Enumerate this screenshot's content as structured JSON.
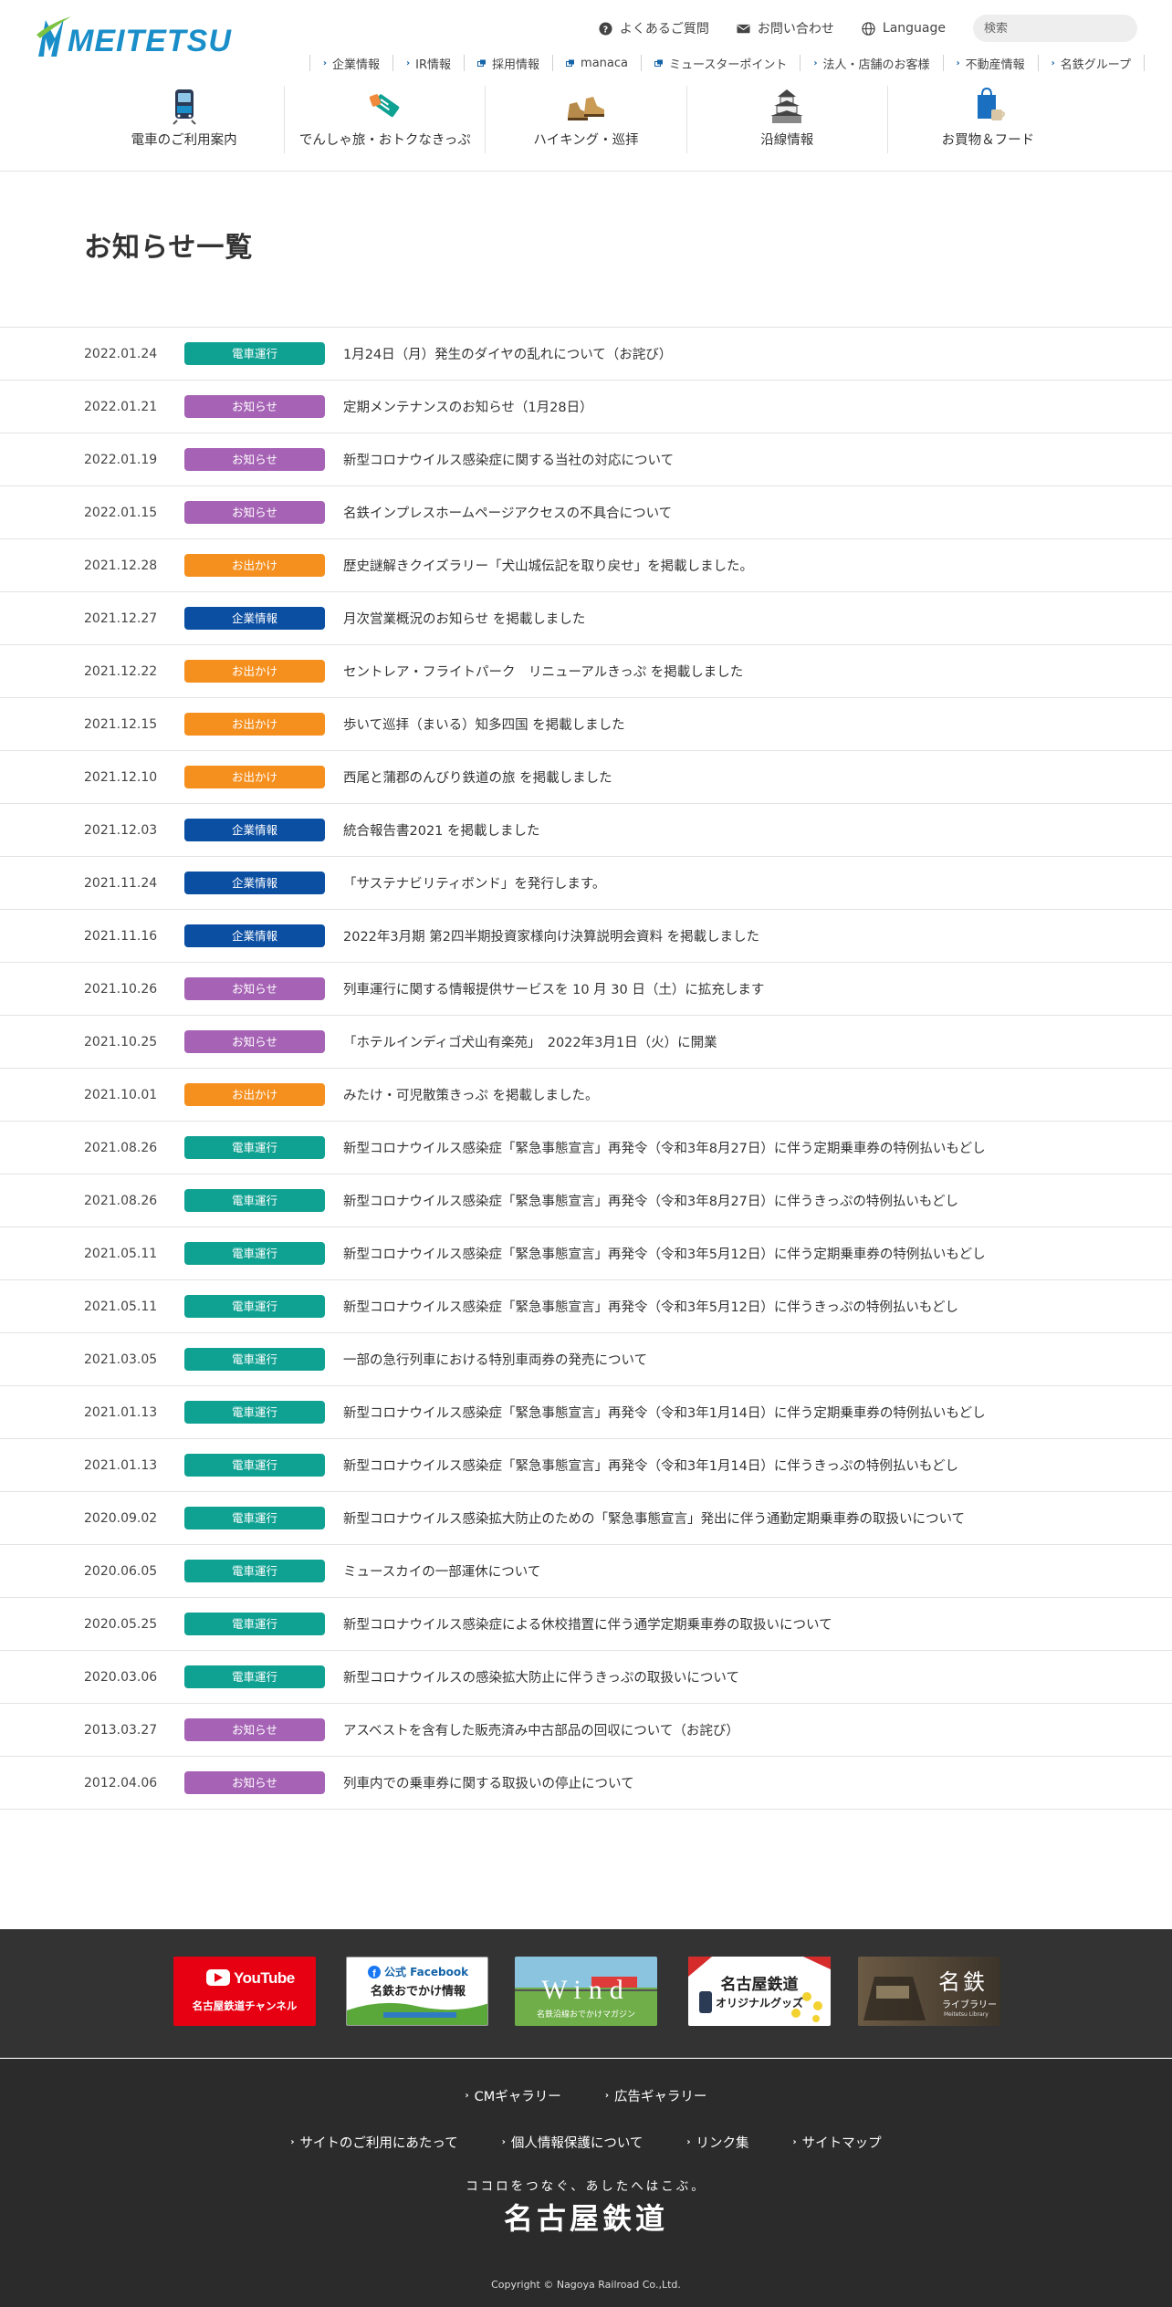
{
  "header": {
    "logo_text": "MEITETSU",
    "util": {
      "faq": "よくあるご質問",
      "contact": "お問い合わせ",
      "language": "Language",
      "search_placeholder": "検索"
    },
    "subnav": [
      "企業情報",
      "IR情報",
      "採用情報",
      "manaca",
      "ミュースターポイント",
      "法人・店舗のお客様",
      "不動産情報",
      "名鉄グループ"
    ],
    "mainnav": [
      {
        "label": "電車のご利用案内",
        "icon": "train-icon"
      },
      {
        "label": "でんしゃ旅・おトクなきっぷ",
        "icon": "ticket-icon"
      },
      {
        "label": "ハイキング・巡拝",
        "icon": "hiking-boots-icon"
      },
      {
        "label": "沿線情報",
        "icon": "castle-icon"
      },
      {
        "label": "お買物＆フード",
        "icon": "shopping-bag-icon"
      }
    ]
  },
  "page_title": "お知らせ一覧",
  "categories": {
    "train": {
      "label": "電車運行",
      "color": "#0fa192"
    },
    "notice": {
      "label": "お知らせ",
      "color": "#a663b5"
    },
    "outing": {
      "label": "お出かけ",
      "color": "#f5901f"
    },
    "corporate": {
      "label": "企業情報",
      "color": "#0b4fa3"
    }
  },
  "news": [
    {
      "date": "2022.01.24",
      "cat": "train",
      "label": "電車運行",
      "title": "1月24日（月）発生のダイヤの乱れについて（お詫び）"
    },
    {
      "date": "2022.01.21",
      "cat": "notice",
      "label": "お知らせ",
      "title": "定期メンテナンスのお知らせ（1月28日）"
    },
    {
      "date": "2022.01.19",
      "cat": "notice",
      "label": "お知らせ",
      "title": "新型コロナウイルス感染症に関する当社の対応について"
    },
    {
      "date": "2022.01.15",
      "cat": "notice",
      "label": "お知らせ",
      "title": "名鉄インプレスホームページアクセスの不具合について"
    },
    {
      "date": "2021.12.28",
      "cat": "outing",
      "label": "お出かけ",
      "title": "歴史謎解きクイズラリー「犬山城伝記を取り戻せ」を掲載しました。"
    },
    {
      "date": "2021.12.27",
      "cat": "corporate",
      "label": "企業情報",
      "title": "月次営業概況のお知らせ を掲載しました"
    },
    {
      "date": "2021.12.22",
      "cat": "outing",
      "label": "お出かけ",
      "title": "セントレア・フライトパーク　リニューアルきっぷ を掲載しました"
    },
    {
      "date": "2021.12.15",
      "cat": "outing",
      "label": "お出かけ",
      "title": "歩いて巡拝（まいる）知多四国 を掲載しました"
    },
    {
      "date": "2021.12.10",
      "cat": "outing",
      "label": "お出かけ",
      "title": "西尾と蒲郡のんびり鉄道の旅 を掲載しました"
    },
    {
      "date": "2021.12.03",
      "cat": "corporate",
      "label": "企業情報",
      "title": "統合報告書2021 を掲載しました"
    },
    {
      "date": "2021.11.24",
      "cat": "corporate",
      "label": "企業情報",
      "title": "「サステナビリティボンド」を発行します。"
    },
    {
      "date": "2021.11.16",
      "cat": "corporate",
      "label": "企業情報",
      "title": "2022年3月期 第2四半期投資家様向け決算説明会資料 を掲載しました"
    },
    {
      "date": "2021.10.26",
      "cat": "notice",
      "label": "お知らせ",
      "title": "列車運行に関する情報提供サービスを 10 月 30 日（土）に拡充します"
    },
    {
      "date": "2021.10.25",
      "cat": "notice",
      "label": "お知らせ",
      "title": "「ホテルインディゴ犬山有楽苑」　2022年3月1日（火）に開業"
    },
    {
      "date": "2021.10.01",
      "cat": "outing",
      "label": "お出かけ",
      "title": "みたけ・可児散策きっぷ を掲載しました。"
    },
    {
      "date": "2021.08.26",
      "cat": "train",
      "label": "電車運行",
      "title": "新型コロナウイルス感染症「緊急事態宣言」再発令（令和3年8月27日）に伴う定期乗車券の特例払いもどし"
    },
    {
      "date": "2021.08.26",
      "cat": "train",
      "label": "電車運行",
      "title": "新型コロナウイルス感染症「緊急事態宣言」再発令（令和3年8月27日）に伴うきっぷの特例払いもどし"
    },
    {
      "date": "2021.05.11",
      "cat": "train",
      "label": "電車運行",
      "title": "新型コロナウイルス感染症「緊急事態宣言」再発令（令和3年5月12日）に伴う定期乗車券の特例払いもどし"
    },
    {
      "date": "2021.05.11",
      "cat": "train",
      "label": "電車運行",
      "title": "新型コロナウイルス感染症「緊急事態宣言」再発令（令和3年5月12日）に伴うきっぷの特例払いもどし"
    },
    {
      "date": "2021.03.05",
      "cat": "train",
      "label": "電車運行",
      "title": "一部の急行列車における特別車両券の発売について"
    },
    {
      "date": "2021.01.13",
      "cat": "train",
      "label": "電車運行",
      "title": "新型コロナウイルス感染症「緊急事態宣言」再発令（令和3年1月14日）に伴う定期乗車券の特例払いもどし"
    },
    {
      "date": "2021.01.13",
      "cat": "train",
      "label": "電車運行",
      "title": "新型コロナウイルス感染症「緊急事態宣言」再発令（令和3年1月14日）に伴うきっぷの特例払いもどし"
    },
    {
      "date": "2020.09.02",
      "cat": "train",
      "label": "電車運行",
      "title": "新型コロナウイルス感染拡大防止のための「緊急事態宣言」発出に伴う通勤定期乗車券の取扱いについて"
    },
    {
      "date": "2020.06.05",
      "cat": "train",
      "label": "電車運行",
      "title": "ミュースカイの一部運休について"
    },
    {
      "date": "2020.05.25",
      "cat": "train",
      "label": "電車運行",
      "title": "新型コロナウイルス感染症による休校措置に伴う通学定期乗車券の取扱いについて"
    },
    {
      "date": "2020.03.06",
      "cat": "train",
      "label": "電車運行",
      "title": "新型コロナウイルスの感染拡大防止に伴うきっぷの取扱いについて"
    },
    {
      "date": "2013.03.27",
      "cat": "notice",
      "label": "お知らせ",
      "title": "アスベストを含有した販売済み中古部品の回収について（お詫び）"
    },
    {
      "date": "2012.04.06",
      "cat": "notice",
      "label": "お知らせ",
      "title": "列車内での乗車券に関する取扱いの停止について"
    }
  ],
  "footer": {
    "banners": {
      "youtube": {
        "title": "YouTube",
        "sub": "名古屋鉄道チャンネル"
      },
      "facebook": {
        "title": "公式 Facebook",
        "sub": "名鉄おでかけ情報"
      },
      "wind": {
        "title": "Wind",
        "sub": "名鉄沿線おでかけマガジン"
      },
      "goods": {
        "title": "名古屋鉄道",
        "sub": "オリジナルグッズ"
      },
      "library": {
        "title": "名鉄",
        "sub": "ライブラリー",
        "sub2": "Meitetsu Library"
      }
    },
    "links_row1": [
      "CMギャラリー",
      "広告ギャラリー"
    ],
    "links_row2": [
      "サイトのご利用にあたって",
      "個人情報保護について",
      "リンク集",
      "サイトマップ"
    ],
    "tagline": "ココロをつなぐ、あしたへはこぶ。",
    "corp_name": "名古屋鉄道",
    "copyright": "Copyright © Nagoya Railroad Co.,Ltd."
  }
}
